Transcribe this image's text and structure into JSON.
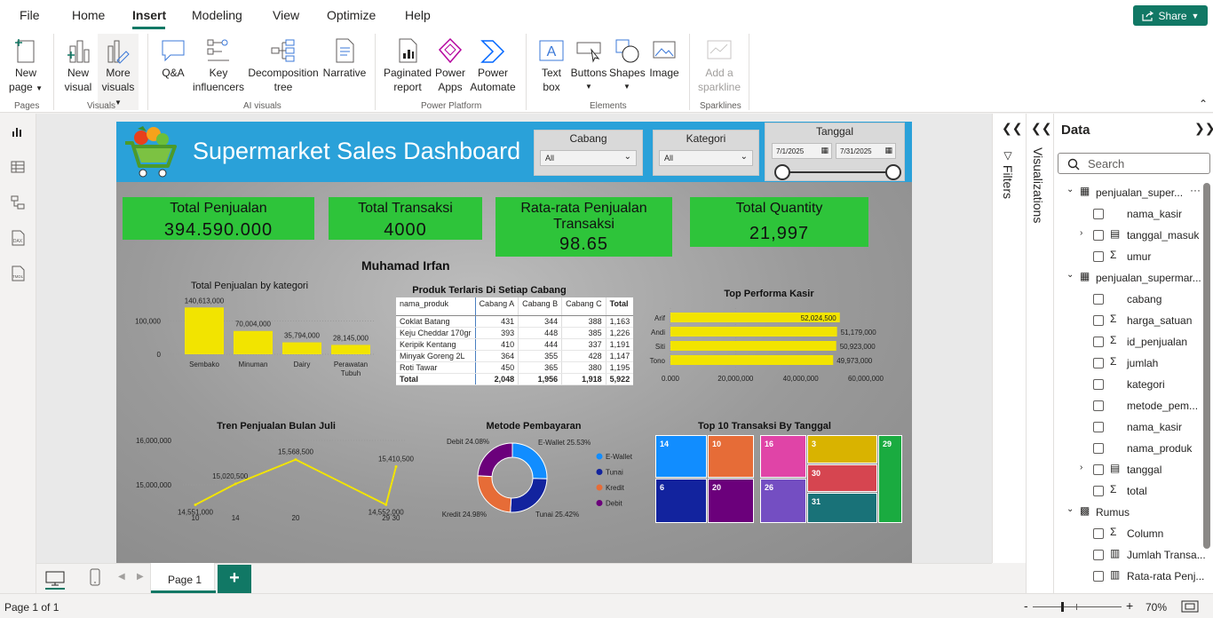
{
  "menu": {
    "file": "File",
    "home": "Home",
    "insert": "Insert",
    "modeling": "Modeling",
    "view": "View",
    "optimize": "Optimize",
    "help": "Help",
    "share": "Share"
  },
  "ribbon": {
    "new_page": [
      "New",
      "page"
    ],
    "new_visual": [
      "New",
      "visual"
    ],
    "more_visuals": [
      "More",
      "visuals"
    ],
    "qa": "Q&A",
    "key_influencers": [
      "Key",
      "influencers"
    ],
    "decomposition_tree": [
      "Decomposition",
      "tree"
    ],
    "narrative": "Narrative",
    "paginated_report": [
      "Paginated",
      "report"
    ],
    "power_apps": [
      "Power",
      "Apps"
    ],
    "power_automate": [
      "Power",
      "Automate"
    ],
    "text_box": [
      "Text",
      "box"
    ],
    "buttons": "Buttons",
    "shapes": "Shapes",
    "image": "Image",
    "add_sparkline": [
      "Add a",
      "sparkline"
    ],
    "groups": {
      "pages": "Pages",
      "visuals": "Visuals",
      "ai_visuals": "AI visuals",
      "power_platform": "Power Platform",
      "elements": "Elements",
      "sparklines": "Sparklines"
    }
  },
  "report": {
    "title": "Supermarket Sales Dashboard",
    "slicers": {
      "cabang_label": "Cabang",
      "cabang_value": "All",
      "kategori_label": "Kategori",
      "kategori_value": "All",
      "tanggal_label": "Tanggal",
      "date_start": "7/1/2025",
      "date_end": "7/31/2025"
    },
    "kpis": [
      {
        "title": "Total Penjualan",
        "value": "394.590.000"
      },
      {
        "title": "Total Transaksi",
        "value": "4000"
      },
      {
        "title": "Rata-rata Penjualan Transaksi",
        "value": "98.65"
      },
      {
        "title": "Total Quantity",
        "value": "21,997"
      }
    ],
    "author": "Muhamad Irfan"
  },
  "chart_data": [
    {
      "type": "bar",
      "title": "Total Penjualan by kategori",
      "categories": [
        "Sembako",
        "Minuman",
        "Dairy",
        "Perawatan Tubuh"
      ],
      "category_lines": [
        [
          "Sembako"
        ],
        [
          "Minuman"
        ],
        [
          "Dairy"
        ],
        [
          "Perawatan",
          "Tubuh"
        ]
      ],
      "values": [
        140613000,
        70004000,
        35794000,
        28145000
      ],
      "value_labels": [
        "140,613,000",
        "70,004,000",
        "35,794,000",
        "28,145,000"
      ],
      "yticks": [
        0,
        100000000
      ],
      "ytick_labels": [
        "0",
        "100,000"
      ],
      "ylim": [
        0,
        160000000
      ],
      "color": "#f2e400"
    },
    {
      "type": "table",
      "title": "Produk Terlaris Di Setiap Cabang",
      "columns": [
        "nama_produk",
        "Cabang A",
        "Cabang B",
        "Cabang C",
        "Total"
      ],
      "rows": [
        [
          "Coklat Batang",
          "431",
          "344",
          "388",
          "1,163"
        ],
        [
          "Keju Cheddar 170gr",
          "393",
          "448",
          "385",
          "1,226"
        ],
        [
          "Keripik Kentang",
          "410",
          "444",
          "337",
          "1,191"
        ],
        [
          "Minyak Goreng 2L",
          "364",
          "355",
          "428",
          "1,147"
        ],
        [
          "Roti Tawar",
          "450",
          "365",
          "380",
          "1,195"
        ]
      ],
      "total": [
        "Total",
        "2,048",
        "1,956",
        "1,918",
        "5,922"
      ]
    },
    {
      "type": "bar",
      "orientation": "horizontal",
      "title": "Top Performa Kasir",
      "categories": [
        "Arif",
        "Andi",
        "Siti",
        "Tono"
      ],
      "values": [
        52024500,
        51179000,
        50923000,
        49973000
      ],
      "value_labels": [
        "52,024,500",
        "51,179,000",
        "50,923,000",
        "49,973,000"
      ],
      "xticks": [
        0,
        20000000,
        40000000,
        60000000
      ],
      "xtick_labels": [
        "0.000",
        "20,000,000",
        "40,000,000",
        "60,000,000"
      ],
      "xlim": [
        0,
        60000000
      ],
      "color": "#f2e400"
    },
    {
      "type": "line",
      "title": "Tren Penjualan Bulan Juli",
      "x": [
        10,
        14,
        20,
        29,
        30
      ],
      "x_labels": [
        "10",
        "14",
        "20",
        "29",
        "30"
      ],
      "values": [
        14551000,
        15020500,
        15568500,
        14552000,
        15410500
      ],
      "value_labels": [
        "14,551,000",
        "15,020,500",
        "15,568,500",
        "14,552,000",
        "15,410,500"
      ],
      "yticks": [
        15000000,
        16000000
      ],
      "ytick_labels": [
        "15,000,000",
        "16,000,000"
      ],
      "ylim": [
        14500000,
        16000000
      ],
      "color": "#f2e400"
    },
    {
      "type": "pie",
      "title": "Metode Pembayaran",
      "categories": [
        "E-Wallet",
        "Tunai",
        "Kredit",
        "Debit"
      ],
      "values": [
        25.53,
        25.42,
        24.98,
        24.08
      ],
      "value_labels": [
        "E-Wallet 25.53%",
        "Tunai 25.42%",
        "Kredit 24.98%",
        "Debit 24.08%"
      ],
      "colors": [
        "#118dff",
        "#12239e",
        "#e66c37",
        "#6b007b"
      ]
    },
    {
      "type": "heatmap",
      "title": "Top 10 Transaksi By Tanggal",
      "categories": [
        "14",
        "10",
        "16",
        "3",
        "29",
        "6",
        "20",
        "26",
        "30",
        "31"
      ],
      "colors": [
        "#118dff",
        "#e66c37",
        "#e044a7",
        "#d9b300",
        "#1aab40",
        "#12239e",
        "#6b007b",
        "#744ec2",
        "#d64550",
        "#197278"
      ]
    }
  ],
  "panes": {
    "filters": "Filters",
    "visualizations": "Visualizations",
    "data": "Data",
    "search_placeholder": "Search"
  },
  "fields": [
    {
      "name": "penjualan_super...",
      "level": 0,
      "kind": "table",
      "expand": "down"
    },
    {
      "name": "nama_kasir",
      "level": 1,
      "kind": "none"
    },
    {
      "name": "tanggal_masuk",
      "level": 1,
      "kind": "date",
      "expand": "right"
    },
    {
      "name": "umur",
      "level": 1,
      "kind": "sigma"
    },
    {
      "name": "penjualan_supermar...",
      "level": 0,
      "kind": "table",
      "expand": "down"
    },
    {
      "name": "cabang",
      "level": 1,
      "kind": "none"
    },
    {
      "name": "harga_satuan",
      "level": 1,
      "kind": "sigma"
    },
    {
      "name": "id_penjualan",
      "level": 1,
      "kind": "sigma"
    },
    {
      "name": "jumlah",
      "level": 1,
      "kind": "sigma"
    },
    {
      "name": "kategori",
      "level": 1,
      "kind": "none"
    },
    {
      "name": "metode_pem...",
      "level": 1,
      "kind": "none"
    },
    {
      "name": "nama_kasir",
      "level": 1,
      "kind": "none"
    },
    {
      "name": "nama_produk",
      "level": 1,
      "kind": "none"
    },
    {
      "name": "tanggal",
      "level": 1,
      "kind": "date",
      "expand": "right"
    },
    {
      "name": "total",
      "level": 1,
      "kind": "sigma"
    },
    {
      "name": "Rumus",
      "level": 0,
      "kind": "measures",
      "expand": "down"
    },
    {
      "name": "Column",
      "level": 1,
      "kind": "sigma"
    },
    {
      "name": "Jumlah Transa...",
      "level": 1,
      "kind": "calc"
    },
    {
      "name": "Rata-rata Penj...",
      "level": 1,
      "kind": "calc"
    }
  ],
  "bottom": {
    "page_tab": "Page 1",
    "add": "+"
  },
  "status": {
    "page_info": "Page 1 of 1",
    "zoom": "70%",
    "minus": "-",
    "plus": "+"
  }
}
